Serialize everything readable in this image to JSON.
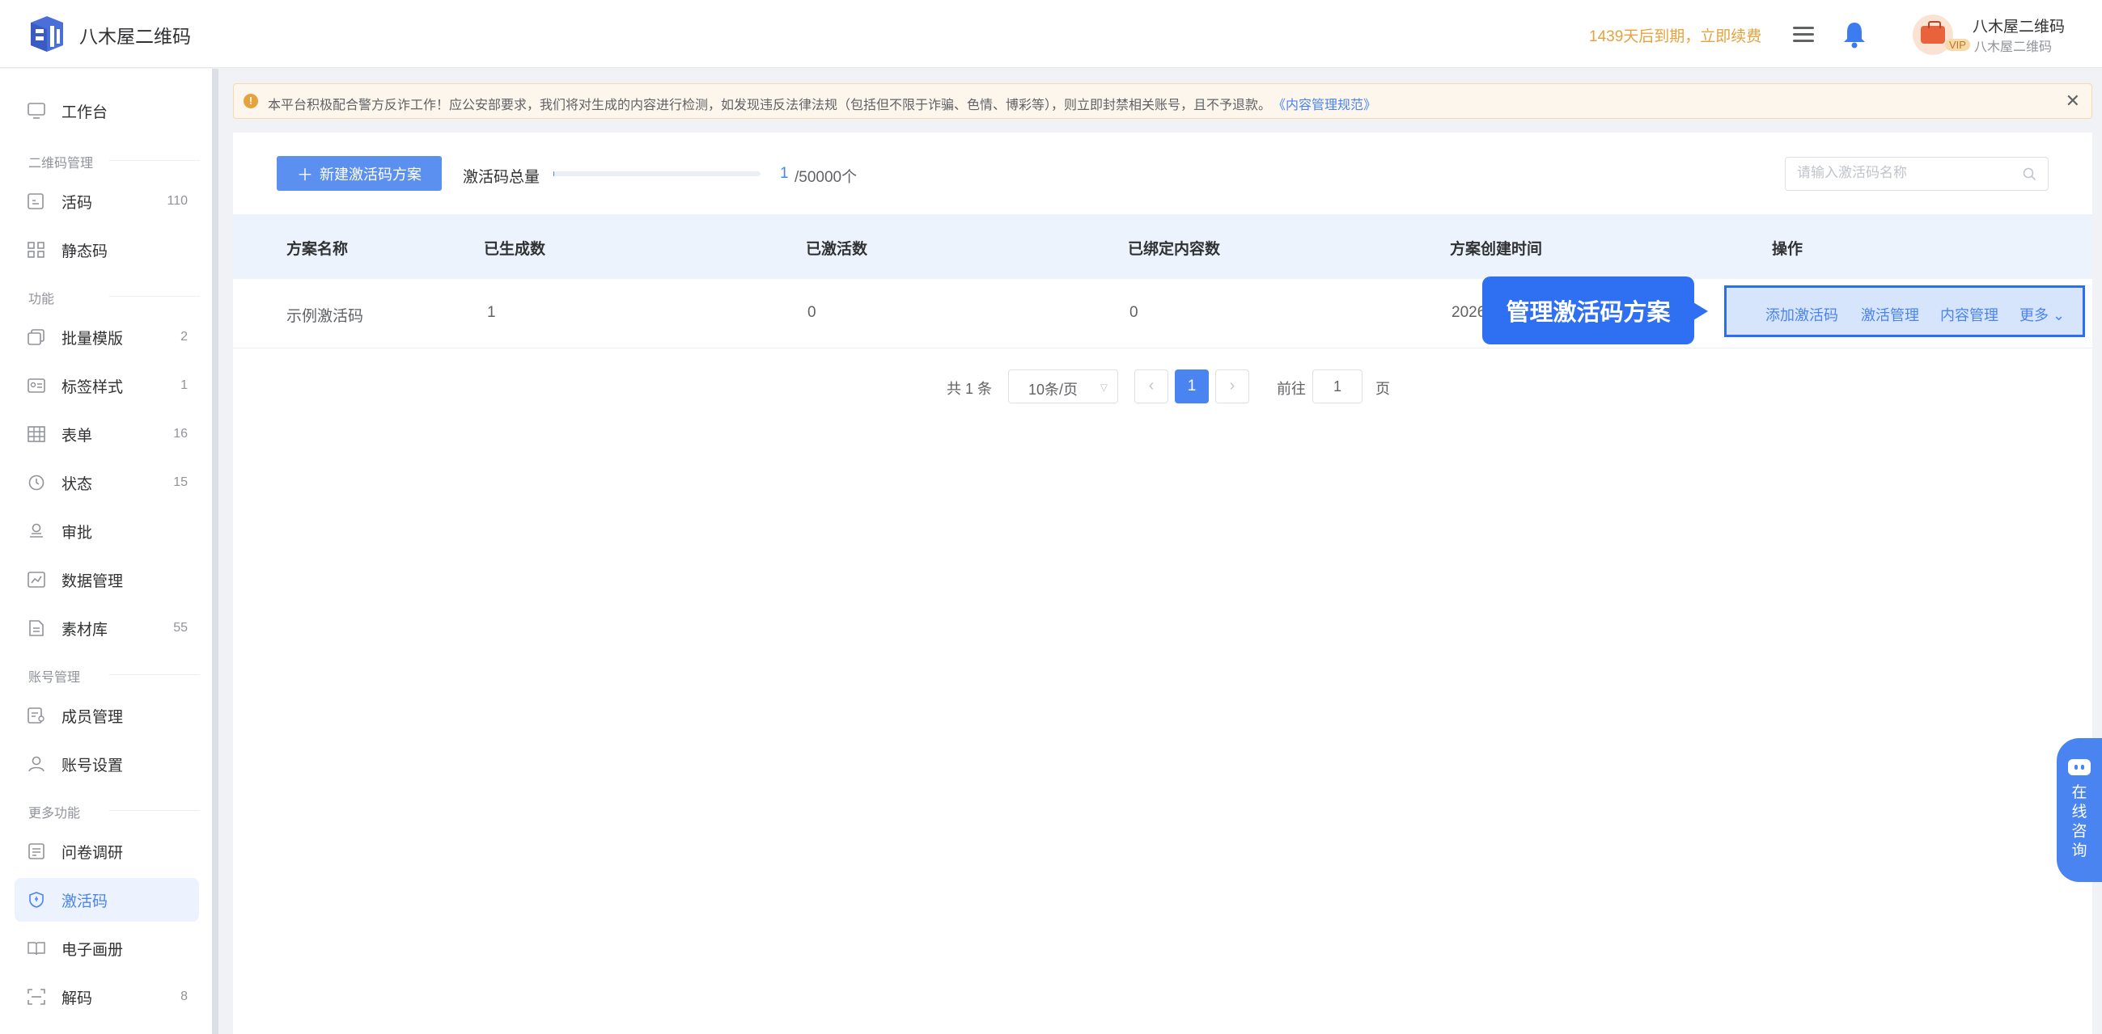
{
  "header": {
    "brand": "八木屋二维码",
    "renew_text": "1439天后到期，立即续费",
    "user_name": "八木屋二维码",
    "user_sub": "八木屋二维码",
    "vip_badge": "VIP"
  },
  "sidebar": {
    "dashboard": "工作台",
    "section_qr": "二维码管理",
    "live_code": {
      "label": "活码",
      "count": "110"
    },
    "static_code": "静态码",
    "section_func": "功能",
    "batch_template": {
      "label": "批量模版",
      "count": "2"
    },
    "label_style": {
      "label": "标签样式",
      "count": "1"
    },
    "form": {
      "label": "表单",
      "count": "16"
    },
    "status": {
      "label": "状态",
      "count": "15"
    },
    "approval": "审批",
    "data_mgmt": "数据管理",
    "material": {
      "label": "素材库",
      "count": "55"
    },
    "section_account": "账号管理",
    "members": "成员管理",
    "account_settings": "账号设置",
    "section_more": "更多功能",
    "survey": "问卷调研",
    "activation_code": "激活码",
    "ebook": "电子画册",
    "decode": {
      "label": "解码",
      "count": "8"
    }
  },
  "notice": {
    "text": "本平台积极配合警方反诈工作！应公安部要求，我们将对生成的内容进行检测，如发现违反法律法规（包括但不限于诈骗、色情、博彩等），则立即封禁相关账号，且不予退款。",
    "link": "《内容管理规范》"
  },
  "toolbar": {
    "new_button": "新建激活码方案",
    "total_label": "激活码总量",
    "total_used": "1",
    "total_max": "/50000个",
    "usage_fraction": 2e-05,
    "search_placeholder": "请输入激活码名称"
  },
  "table": {
    "headers": [
      "方案名称",
      "已生成数",
      "已激活数",
      "已绑定内容数",
      "方案创建时间",
      "操作"
    ],
    "rows": [
      {
        "name": "示例激活码",
        "generated": "1",
        "activated": "0",
        "bound": "0",
        "created": "2026-"
      }
    ],
    "ops": {
      "add": "添加激活码",
      "manage": "激活管理",
      "content": "内容管理",
      "more": "更多"
    }
  },
  "callout": "管理激活码方案",
  "pagination": {
    "total": "共 1 条",
    "page_size": "10条/页",
    "current": "1",
    "goto_label": "前往",
    "goto_value": "1",
    "page_unit": "页"
  },
  "consult": "在线咨询",
  "colors": {
    "accent": "#4a84f0",
    "warning": "#e6a23c",
    "callout": "#2f6ff2"
  }
}
